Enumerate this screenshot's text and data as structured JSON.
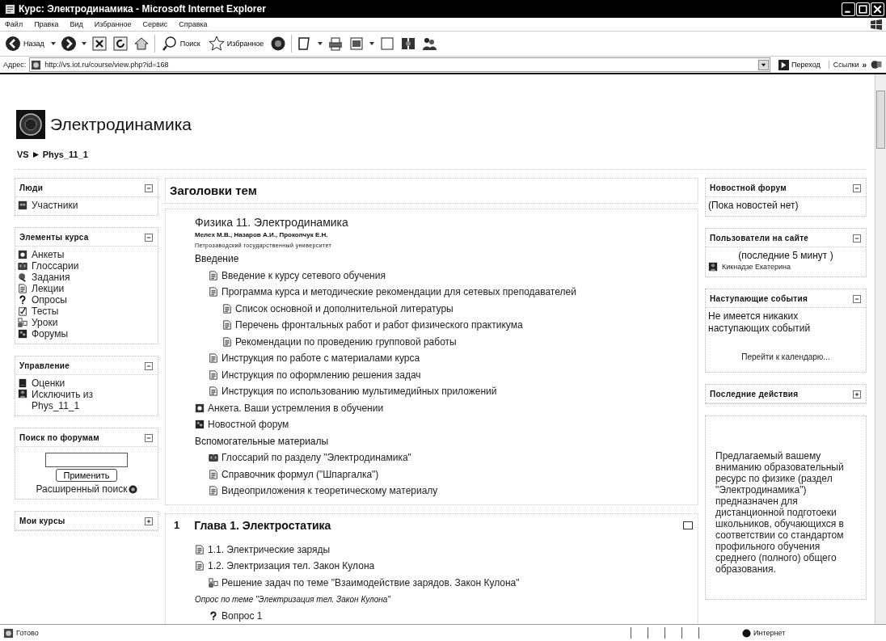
{
  "window": {
    "title": "Курс: Электродинамика - Microsoft Internet Explorer"
  },
  "menu": [
    "Файл",
    "Правка",
    "Вид",
    "Избранное",
    "Сервис",
    "Справка"
  ],
  "toolbar": {
    "back": "Назад",
    "search": "Поиск",
    "favorites": "Избранное"
  },
  "address": {
    "label": "Адрес:",
    "url": "http://vs.iot.ru/course/view.php?id=168",
    "go": "Переход",
    "links": "Ссылки",
    "more": "»"
  },
  "course": {
    "title": "Электродинамика",
    "breadcrumb": [
      "VS",
      "Phys_11_1"
    ]
  },
  "left_blocks": [
    {
      "title": "Люди",
      "expanded": true,
      "lines": [
        {
          "kind": "people",
          "text": "Участники"
        }
      ]
    },
    {
      "title": "Элементы курса",
      "expanded": true,
      "lines": [
        {
          "kind": "survey",
          "text": "Анкеты"
        },
        {
          "kind": "glossary",
          "text": "Глоссарии"
        },
        {
          "kind": "assignment",
          "text": "Задания"
        },
        {
          "kind": "doc",
          "text": "Лекции"
        },
        {
          "kind": "question",
          "text": "Опросы"
        },
        {
          "kind": "quiz",
          "text": "Тесты"
        },
        {
          "kind": "lesson",
          "text": "Уроки"
        },
        {
          "kind": "forum",
          "text": "Форумы"
        }
      ]
    },
    {
      "title": "Управление",
      "expanded": true,
      "lines": [
        {
          "kind": "grades",
          "text": "Оценки"
        },
        {
          "kind": "unenrol",
          "text": "Исключить из Phys_11_1"
        }
      ]
    },
    {
      "title": "Поиск по форумам",
      "expanded": true,
      "lines": [
        {
          "kind": "field"
        },
        {
          "kind": "button",
          "text": "Применить"
        },
        {
          "kind": "helplink",
          "text": "Расширенный поиск"
        }
      ]
    },
    {
      "title": "Мои курсы",
      "expanded": false
    }
  ],
  "topics": {
    "title": "Заголовки тем",
    "intro": [
      {
        "kind": "heading",
        "text": "Физика 11. Электродинамика"
      },
      {
        "kind": "authors",
        "text": "Мелех М.В., Назаров А.И., Прокопчук Е.Н."
      },
      {
        "kind": "small",
        "text": "Петрозаводский государственный университет"
      }
    ],
    "outline": [
      {
        "kind": "label",
        "text": "Введение",
        "children": [
          {
            "kind": "doc",
            "text": "Введение к курсу сетевого обучения"
          },
          {
            "kind": "doc",
            "text": "Программа курса и методические рекомендации для сетевых преподавателей",
            "children": [
              {
                "kind": "doc",
                "text": "Список основной и дополнительной литературы"
              },
              {
                "kind": "doc",
                "text": "Перечень фронтальных работ и работ физического практикума"
              },
              {
                "kind": "doc",
                "text": "Рекомендации по проведению групповой работы"
              }
            ]
          },
          {
            "kind": "doc",
            "text": "Инструкция по работе с материалами курса"
          },
          {
            "kind": "doc",
            "text": "Инструкция по оформлению решения задач"
          },
          {
            "kind": "doc",
            "text": "Инструкция по использованию мультимедийных приложений"
          }
        ]
      },
      {
        "kind": "survey",
        "text": "Анкета. Ваши устремления в обучении"
      },
      {
        "kind": "forum",
        "text": "Новостной форум"
      },
      {
        "kind": "label",
        "text": "Вспомогательные материалы",
        "children": [
          {
            "kind": "glossary",
            "text": "Глоссарий по разделу \"Электродинамика\""
          },
          {
            "kind": "doc",
            "text": "Справочник формул (\"Шпаргалка\")"
          },
          {
            "kind": "doc",
            "text": "Видеоприложения к теоретическому материалу"
          }
        ]
      }
    ]
  },
  "sections": [
    {
      "number": "1",
      "title": "Глава 1. Электростатика",
      "outline": [
        {
          "kind": "doc",
          "text": "1.1. Электрические заряды"
        },
        {
          "kind": "doc",
          "text": "1.2. Электризация тел. Закон Кулона",
          "children": [
            {
              "kind": "lesson",
              "text": "Решение задач по теме \"Взаимодействие зарядов. Закон Кулона\""
            }
          ]
        },
        {
          "kind": "note",
          "text": "Опрос по теме \"Электризация тел. Закон Кулона\"",
          "children": [
            {
              "kind": "question",
              "text": "Вопрос 1"
            }
          ]
        }
      ]
    }
  ],
  "right_blocks": [
    {
      "title": "Новостной форум",
      "expanded": true,
      "lines": [
        {
          "kind": "text",
          "text": "(Пока новостей нет)"
        }
      ]
    },
    {
      "title": "Пользователи на сайте",
      "expanded": true,
      "lines": [
        {
          "kind": "center",
          "text": "(последние 5 минут )"
        },
        {
          "kind": "user",
          "text": "Кикнадзе Екатерина"
        }
      ]
    },
    {
      "title": "Наступающие события",
      "expanded": true,
      "lines": [
        {
          "kind": "text",
          "text": "Не имеется никаких наступающих событий"
        },
        {
          "kind": "calendar",
          "text": "Перейти к календарю..."
        }
      ]
    },
    {
      "title": "Последние действия",
      "expanded": false
    },
    {
      "lines": [
        {
          "kind": "para",
          "text": "Предлагаемый вашему вниманию образовательный ресурс по физике (раздел \"Электродинамика\") предназначен для дистанционной подготоеки школьников, обучающихся в соответствии со стандартом профильного обучения среднего (полного) общего образования."
        }
      ]
    }
  ],
  "status_bar": {
    "text": "Готово",
    "zone": "Интернет"
  }
}
